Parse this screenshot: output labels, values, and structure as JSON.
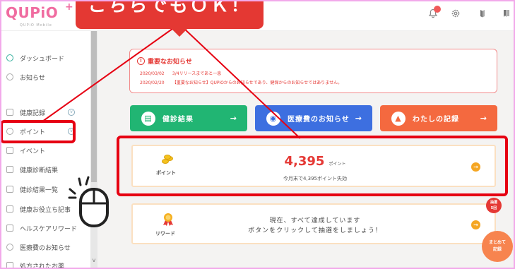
{
  "app": {
    "logo": "QUPiO",
    "logo_plus": "+",
    "logo_sub": "QUPiO Mobile"
  },
  "callout": {
    "text": "こちらでもＯＫ！"
  },
  "header_icons": [
    "bell-icon",
    "gear-icon",
    "book-icon",
    "bookmark-icon"
  ],
  "sidebar": {
    "items": [
      {
        "label": "ダッシュボード",
        "icon": "dashboard-icon"
      },
      {
        "label": "お知らせ",
        "icon": "bell-icon"
      },
      {
        "label": "健康記録",
        "icon": "record-icon"
      },
      {
        "label": "ポイント",
        "icon": "point-icon"
      },
      {
        "label": "イベント",
        "icon": "event-icon"
      },
      {
        "label": "健康診断結果",
        "icon": "checkup-icon"
      },
      {
        "label": "健診結果一覧",
        "icon": "list-icon"
      },
      {
        "label": "健康お役立ち記事",
        "icon": "article-icon"
      },
      {
        "label": "ヘルスケアリワード",
        "icon": "reward-icon"
      },
      {
        "label": "医療費のお知らせ",
        "icon": "medical-icon"
      },
      {
        "label": "処方されたお薬",
        "icon": "medicine-icon"
      }
    ]
  },
  "notice": {
    "title": "重要なお知らせ",
    "rows": [
      {
        "date": "2020/03/02",
        "text": "3/4リリースまであと一息"
      },
      {
        "date": "2020/02/20",
        "text": "【重要なお知らせ】QUPiOからのお知らせであり、健保からのお知らせではありません。"
      }
    ]
  },
  "tiles": [
    {
      "label": "健診結果",
      "color": "#21b573"
    },
    {
      "label": "医療費のお知らせ",
      "color": "#3d6fe0"
    },
    {
      "label": "わたしの記録",
      "color": "#f4693f"
    }
  ],
  "points_card": {
    "label": "ポイント",
    "value": "4,395",
    "unit": "ポイント",
    "sub": "今月末で4,395ポイント失効"
  },
  "reward_card": {
    "label": "リワード",
    "line1": "現在、すべて達成しています",
    "line2": "ボタンをクリックして抽選をしましょう！"
  },
  "lottery_badge": {
    "line1": "抽選",
    "line2": "5回"
  },
  "matome_button": {
    "line1": "まとめて",
    "line2": "記録"
  },
  "colors": {
    "accent": "#e53935",
    "highlight": "#e60012",
    "brand": "#f06ca0"
  }
}
